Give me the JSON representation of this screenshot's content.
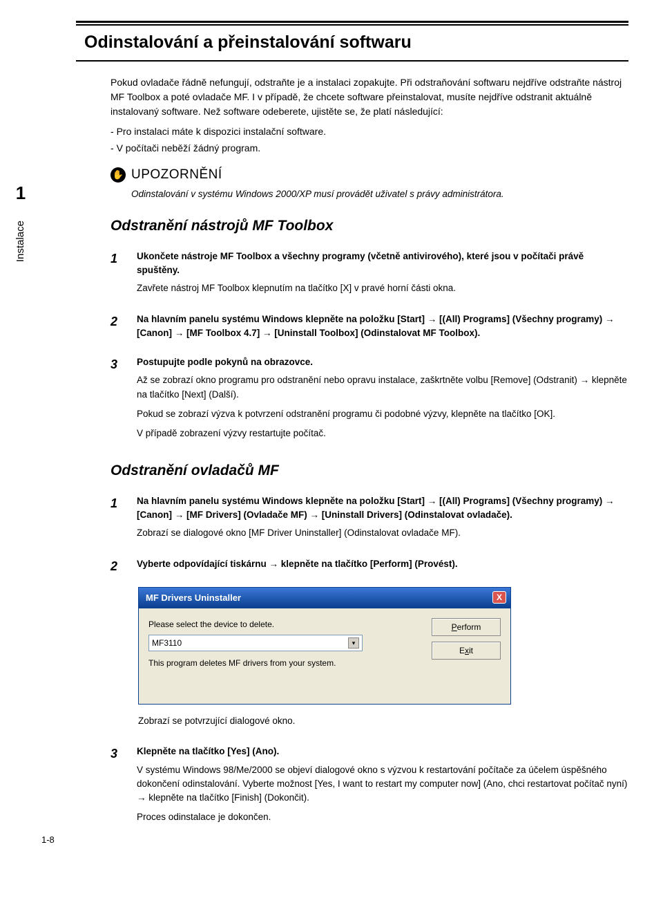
{
  "title": "Odinstalování a přeinstalování softwaru",
  "sidebar": {
    "num": "1",
    "label": "Instalace"
  },
  "intro": "Pokud ovladače řádně nefungují, odstraňte je a instalaci zopakujte. Při odstraňování softwaru nejdříve odstraňte nástroj MF Toolbox a poté ovladače MF. I v případě, že chcete software přeinstalovat, musíte nejdříve odstranit aktuálně instalovaný software. Než software odeberete, ujistěte se, že platí následující:",
  "bullets": [
    "Pro instalaci máte k dispozici instalační software.",
    "V počítači neběží žádný program."
  ],
  "warning_label": "UPOZORNĚNÍ",
  "warning_text": "Odinstalování v systému Windows 2000/XP musí provádět uživatel s právy administrátora.",
  "section_a": {
    "heading": "Odstranění nástrojů MF Toolbox",
    "steps": [
      {
        "n": "1",
        "bold": "Ukončete nástroje MF Toolbox a všechny programy (včetně antivirového), které jsou v počítači právě spuštěny.",
        "paras": [
          "Zavřete nástroj MF Toolbox klepnutím na tlačítko [X] v pravé horní části okna."
        ]
      },
      {
        "n": "2",
        "bold": "Na hlavním panelu systému Windows klepněte na položku [Start] → [(All) Programs] (Všechny programy) → [Canon] → [MF Toolbox 4.7] → [Uninstall Toolbox] (Odinstalovat MF Toolbox).",
        "paras": []
      },
      {
        "n": "3",
        "bold": "Postupujte podle pokynů na obrazovce.",
        "paras": [
          "Až se zobrazí okno programu pro odstranění nebo opravu instalace, zaškrtněte volbu [Remove] (Odstranit) → klepněte na tlačítko [Next] (Další).",
          "Pokud se zobrazí výzva k potvrzení odstranění programu či podobné výzvy, klepněte na tlačítko [OK].",
          "V případě zobrazení výzvy restartujte počítač."
        ]
      }
    ]
  },
  "section_b": {
    "heading": "Odstranění ovladačů MF",
    "steps": [
      {
        "n": "1",
        "bold": "Na hlavním panelu systému Windows klepněte na položku [Start] → [(All) Programs] (Všechny programy) → [Canon] → [MF Drivers] (Ovladače MF) → [Uninstall Drivers] (Odinstalovat ovladače).",
        "paras": [
          "Zobrazí se dialogové okno [MF Driver Uninstaller] (Odinstalovat ovladače MF)."
        ]
      },
      {
        "n": "2",
        "bold": "Vyberte odpovídající tiskárnu → klepněte na tlačítko [Perform] (Provést).",
        "paras": []
      }
    ],
    "after_dialog": "Zobrazí se potvrzující dialogové okno.",
    "step3": {
      "n": "3",
      "bold": "Klepněte na tlačítko [Yes] (Ano).",
      "paras": [
        "V systému Windows 98/Me/2000 se objeví dialogové okno s výzvou k restartování počítače za účelem úspěšného dokončení odinstalování. Vyberte možnost [Yes, I want to restart my computer now] (Ano, chci restartovat počítač nyní) → klepněte na tlačítko [Finish] (Dokončit).",
        "Proces odinstalace je dokončen."
      ]
    }
  },
  "dialog": {
    "title": "MF Drivers Uninstaller",
    "prompt": "Please select the device to delete.",
    "selected": "MF3110",
    "note": "This program deletes MF drivers from your system.",
    "btn_perform": "Perform",
    "btn_exit": "Exit"
  },
  "page_num": "1-8"
}
